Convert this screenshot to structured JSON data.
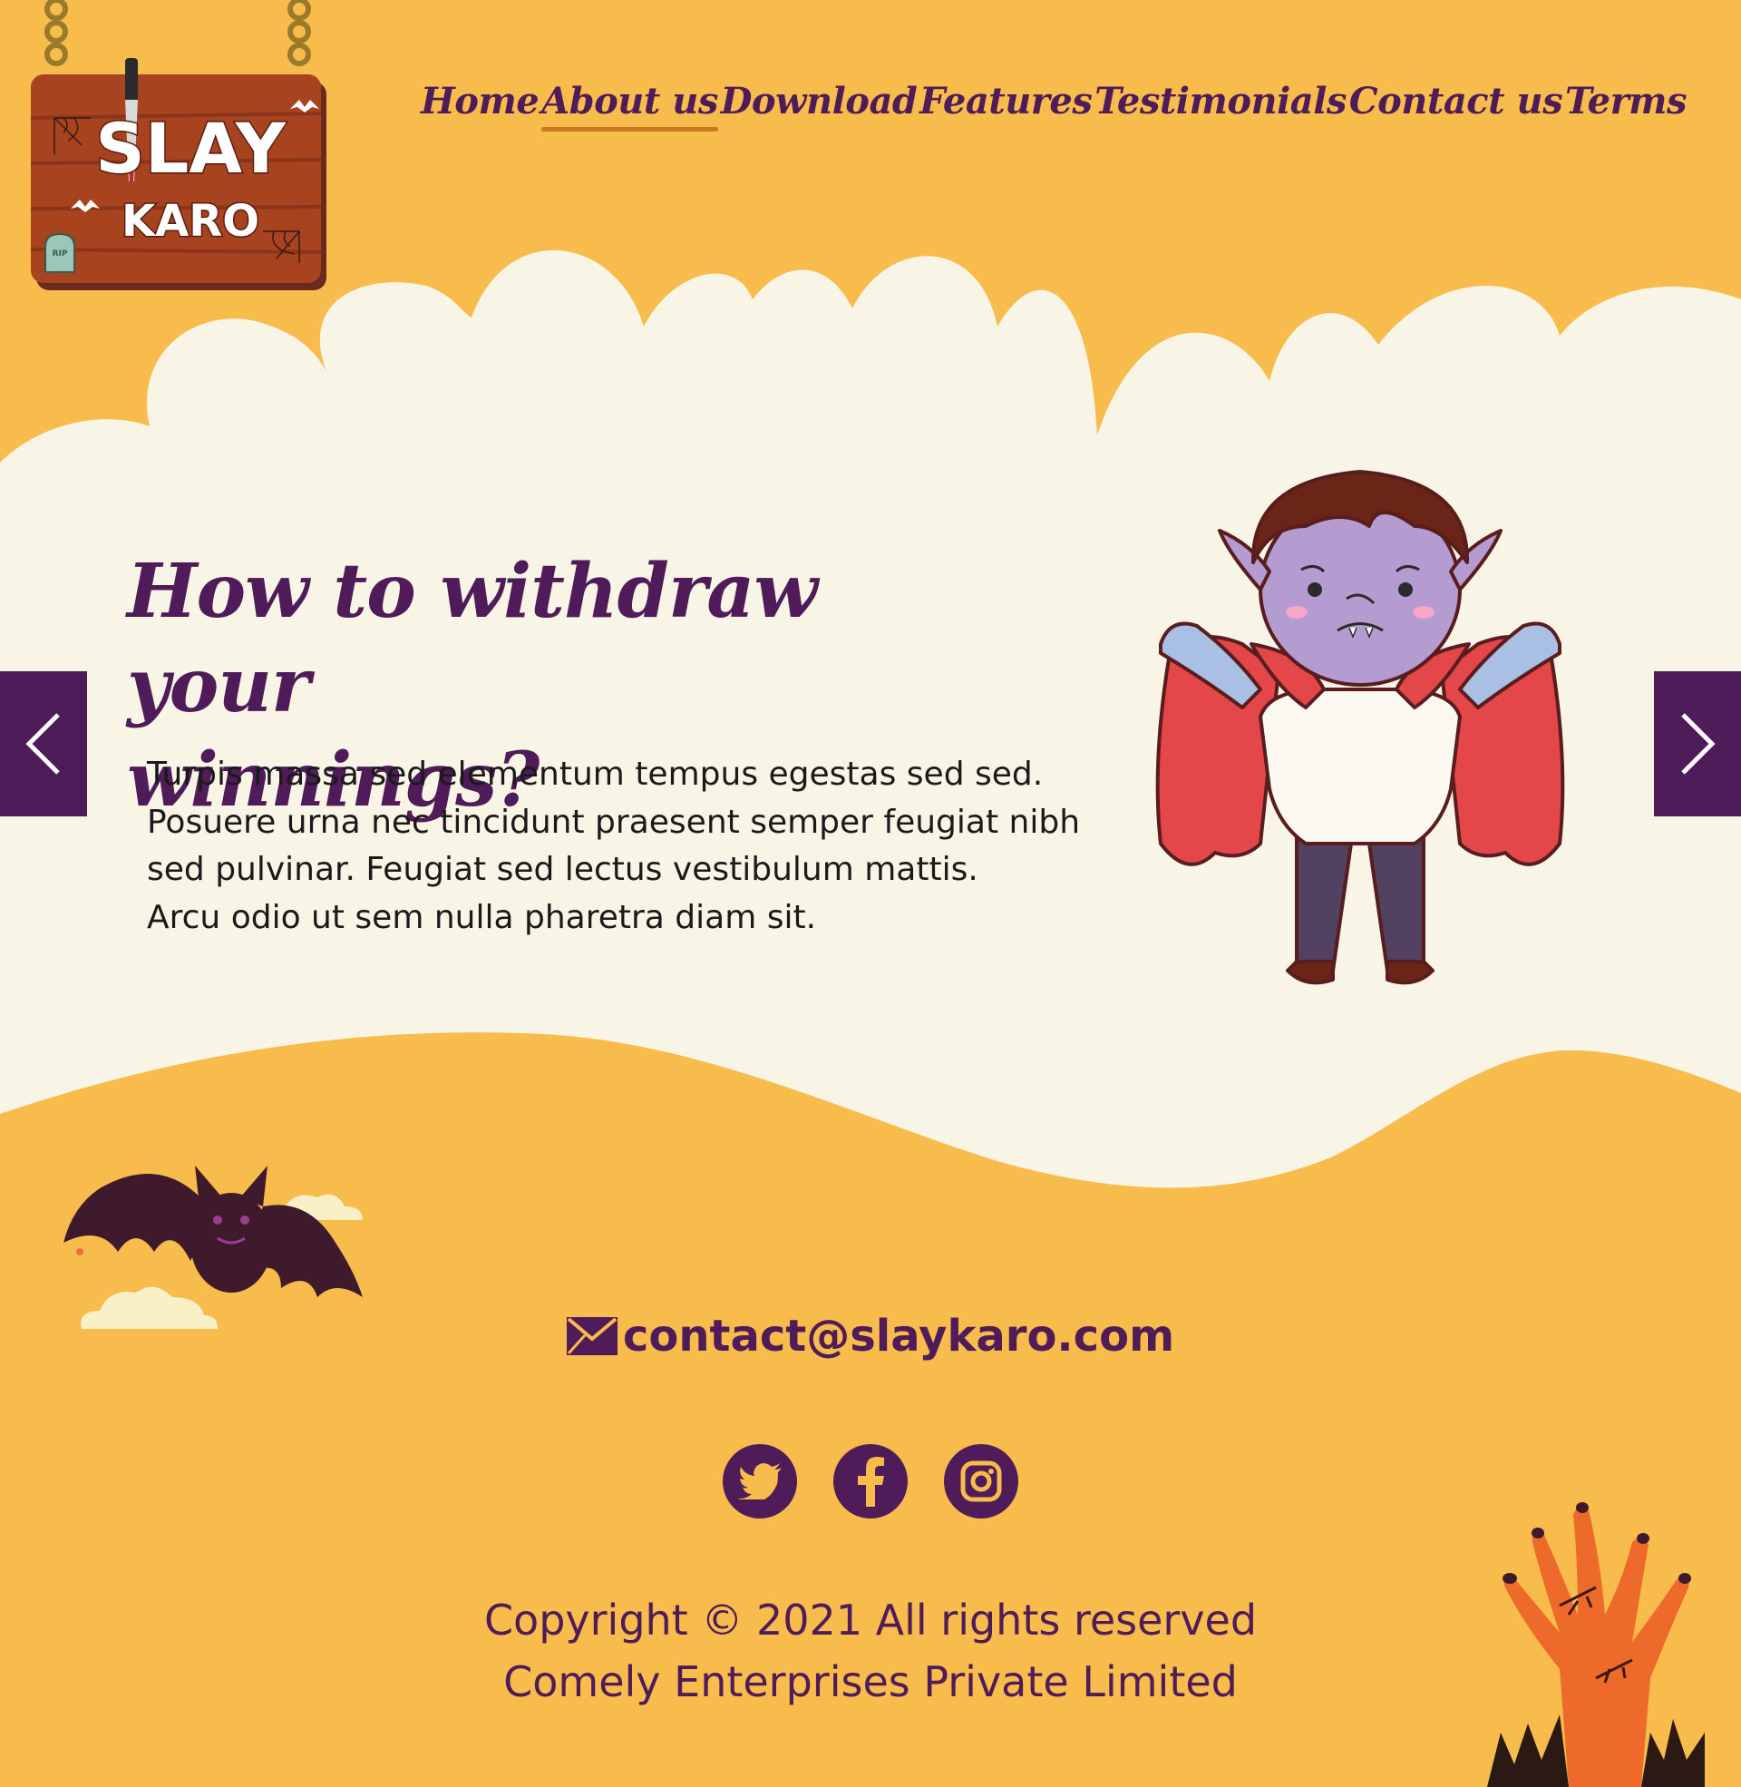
{
  "logo": {
    "line1": "SLAY",
    "line2": "KARO",
    "tomb_text": "RIP"
  },
  "nav": {
    "items": [
      {
        "label": "Home",
        "active": false
      },
      {
        "label": "About us",
        "active": true
      },
      {
        "label": "Download",
        "active": false
      },
      {
        "label": "Features",
        "active": false
      },
      {
        "label": "Testimonials",
        "active": false
      },
      {
        "label": "Contact us",
        "active": false
      },
      {
        "label": "Terms",
        "active": false
      }
    ]
  },
  "slide": {
    "title_line1": "How to withdraw your",
    "title_line2": "winnings?",
    "body_lines": [
      "Turpis massa sed elementum tempus egestas sed sed.",
      "Posuere urna nec tincidunt praesent semper feugiat nibh",
      "sed pulvinar. Feugiat sed lectus vestibulum mattis.",
      "Arcu odio ut sem nulla pharetra diam sit."
    ]
  },
  "carousel": {
    "prev_icon": "chevron-left-icon",
    "next_icon": "chevron-right-icon"
  },
  "footer": {
    "email_icon": "mail-icon",
    "email": "contact@slaykaro.com",
    "social": [
      {
        "name": "twitter-icon"
      },
      {
        "name": "facebook-icon"
      },
      {
        "name": "instagram-icon"
      }
    ],
    "copyright_line1": "Copyright © 2021 All rights reserved",
    "copyright_line2": "Comely Enterprises Private Limited"
  },
  "colors": {
    "background": "#F7BC4B",
    "cloud": "#F9F5E6",
    "primary": "#4F1B58",
    "nav_underline": "#C97A22"
  }
}
